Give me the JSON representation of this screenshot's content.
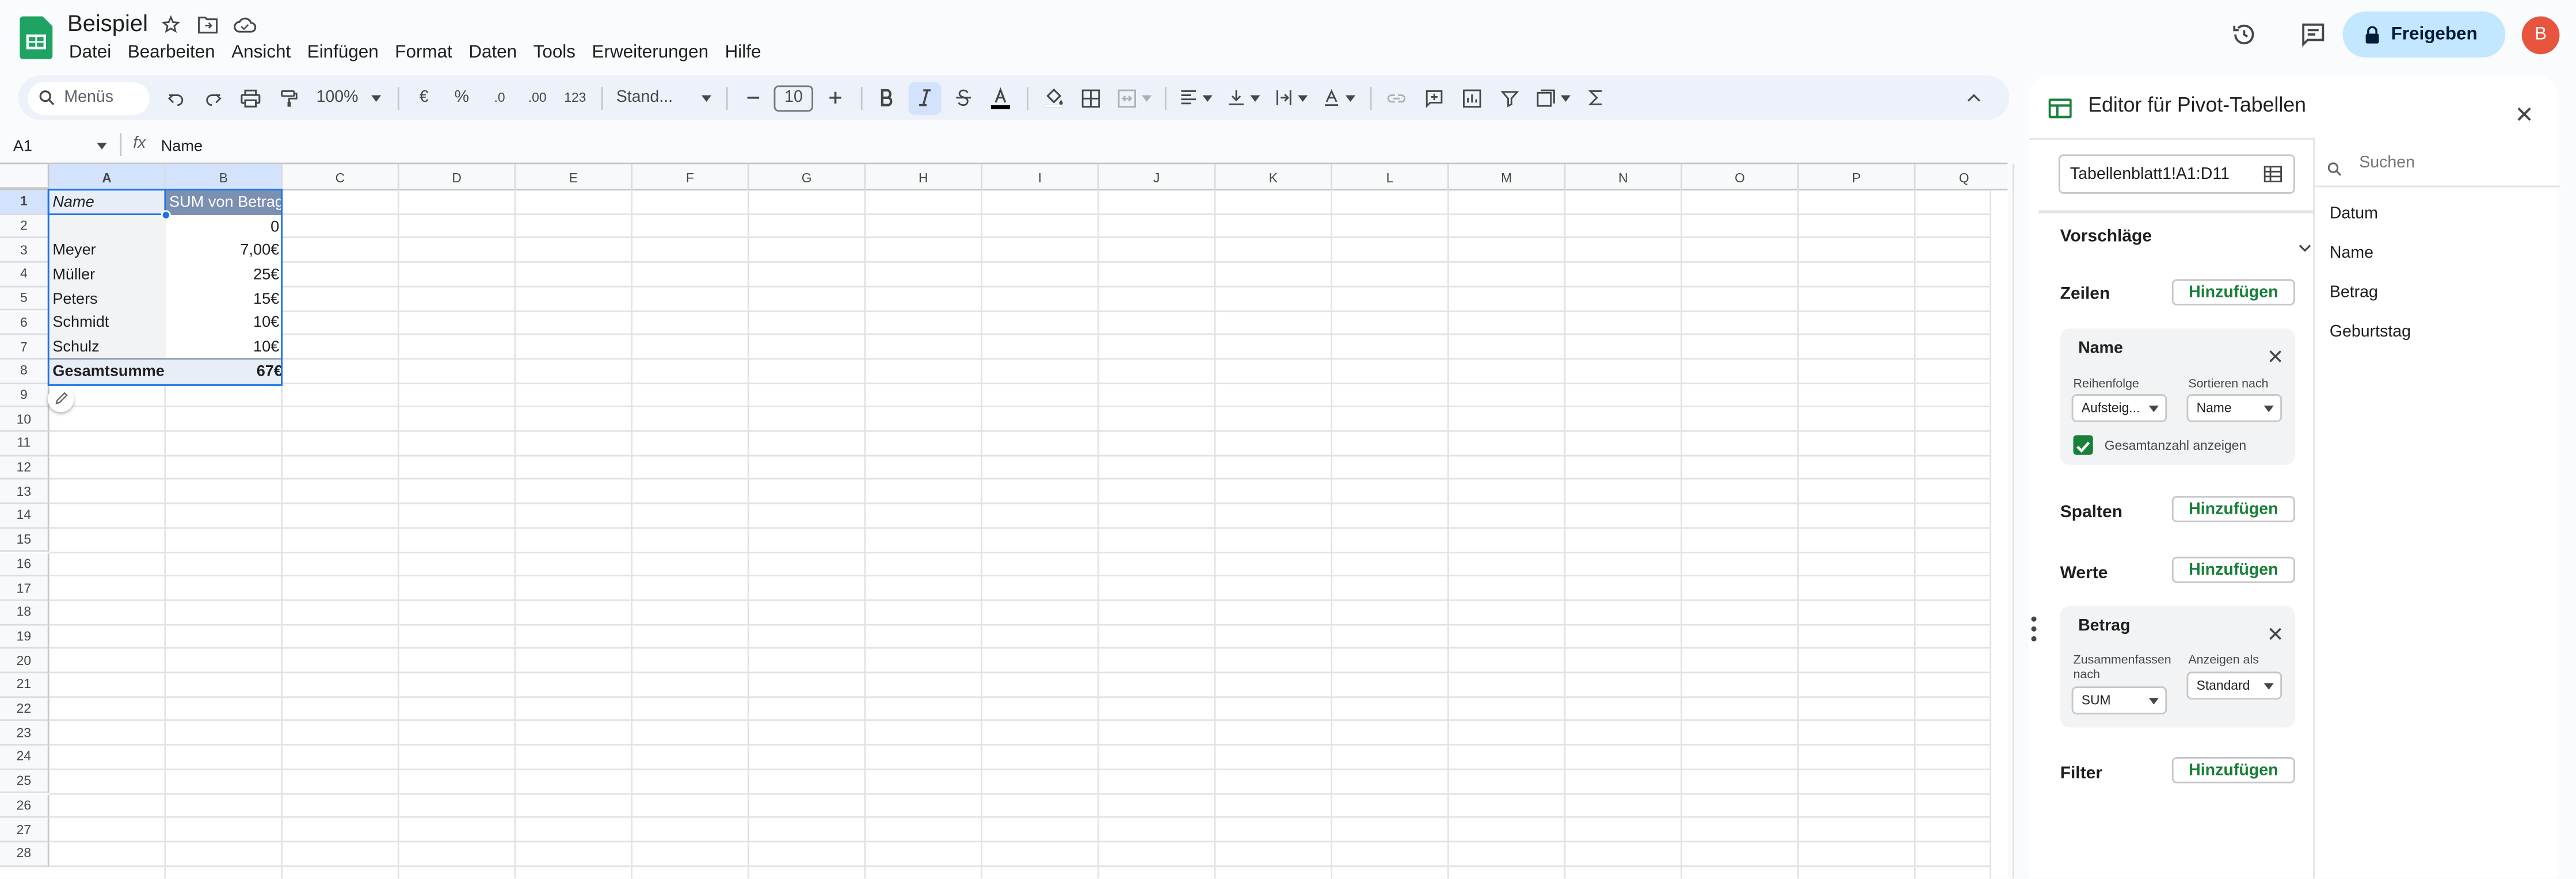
{
  "app": {
    "title": "Beispiel",
    "avatar_letter": "B",
    "share_label": "Freigeben"
  },
  "menu": [
    "Datei",
    "Bearbeiten",
    "Ansicht",
    "Einfügen",
    "Format",
    "Daten",
    "Tools",
    "Erweiterungen",
    "Hilfe"
  ],
  "toolbar": {
    "search_placeholder": "Menüs",
    "zoom": "100%",
    "currency": "€",
    "percent": "%",
    "dec_less": ".0",
    "dec_more": ".00",
    "num_format": "123",
    "font": "Stand...",
    "font_size": "10"
  },
  "formula_bar": {
    "cell_ref": "A1",
    "fx": "fx",
    "value": "Name"
  },
  "columns": [
    "A",
    "B",
    "C",
    "D",
    "E",
    "F",
    "G",
    "H",
    "I",
    "J",
    "K",
    "L",
    "M",
    "N",
    "O",
    "P",
    "Q"
  ],
  "rows": [
    "1",
    "2",
    "3",
    "4",
    "5",
    "6",
    "7",
    "8",
    "9",
    "10",
    "11",
    "12",
    "13",
    "14",
    "15",
    "16",
    "17",
    "18",
    "19",
    "20",
    "21",
    "22",
    "23",
    "24",
    "25",
    "26",
    "27",
    "28"
  ],
  "table": {
    "header": [
      "Name",
      "SUM von Betrag"
    ],
    "rows": [
      [
        "",
        "0"
      ],
      [
        "Meyer",
        "7,00€"
      ],
      [
        "Müller",
        "25€"
      ],
      [
        "Peters",
        "15€"
      ],
      [
        "Schmidt",
        "10€"
      ],
      [
        "Schulz",
        "10€"
      ]
    ],
    "total": [
      "Gesamtsumme",
      "67€"
    ]
  },
  "panel": {
    "title": "Editor für Pivot-Tabellen",
    "range": "Tabellenblatt1!A1:D11",
    "suggestions": "Vorschläge",
    "rows_label": "Zeilen",
    "columns_label": "Spalten",
    "values_label": "Werte",
    "filter_label": "Filter",
    "add_label": "Hinzufügen",
    "row_card": {
      "title": "Name",
      "order_label": "Reihenfolge",
      "order_value": "Aufsteig...",
      "sort_label": "Sortieren nach",
      "sort_value": "Name",
      "total_label": "Gesamtanzahl anzeigen",
      "total_checked": true
    },
    "value_card": {
      "title": "Betrag",
      "summarize_label": "Zusammenfassen nach",
      "summarize_value": "SUM",
      "show_as_label": "Anzeigen als",
      "show_as_value": "Standard"
    },
    "search_placeholder": "Suchen",
    "fields": [
      "Datum",
      "Name",
      "Betrag",
      "Geburtstag"
    ]
  },
  "colors": {
    "accent": "#0b57d0",
    "add_green": "#188038",
    "share_bg": "#c2e7ff",
    "selection": "#d3e3fd"
  }
}
